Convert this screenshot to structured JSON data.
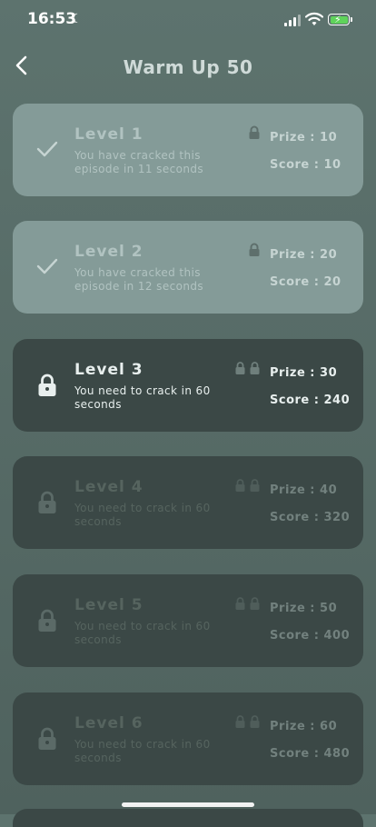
{
  "status": {
    "time": "16:53"
  },
  "header": {
    "title": "Warm Up 50"
  },
  "levels": [
    {
      "name": "Level 1",
      "desc": "You have cracked this episode in 11 seconds",
      "prize": "Prize : 10",
      "score": "Score : 10",
      "state": "done"
    },
    {
      "name": "Level 2",
      "desc": "You have cracked this episode in 12 seconds",
      "prize": "Prize : 20",
      "score": "Score : 20",
      "state": "done"
    },
    {
      "name": "Level 3",
      "desc": "You need to crack in 60 seconds",
      "prize": "Prize : 30",
      "score": "Score : 240",
      "state": "current"
    },
    {
      "name": "Level 4",
      "desc": "You need to crack in 60 seconds",
      "prize": "Prize : 40",
      "score": "Score : 320",
      "state": "locked"
    },
    {
      "name": "Level 5",
      "desc": "You need to crack in 60 seconds",
      "prize": "Prize : 50",
      "score": "Score : 400",
      "state": "locked"
    },
    {
      "name": "Level 6",
      "desc": "You need to crack in 60 seconds",
      "prize": "Prize : 60",
      "score": "Score : 480",
      "state": "locked"
    }
  ],
  "icons": {
    "completed": "check-icon",
    "locked": "lock-icon",
    "back": "chevron-left-icon"
  },
  "colors": {
    "background": "#5d736e",
    "card_done": "#849b98",
    "card_dark": "#3b4846",
    "battery": "#5fd35b"
  }
}
